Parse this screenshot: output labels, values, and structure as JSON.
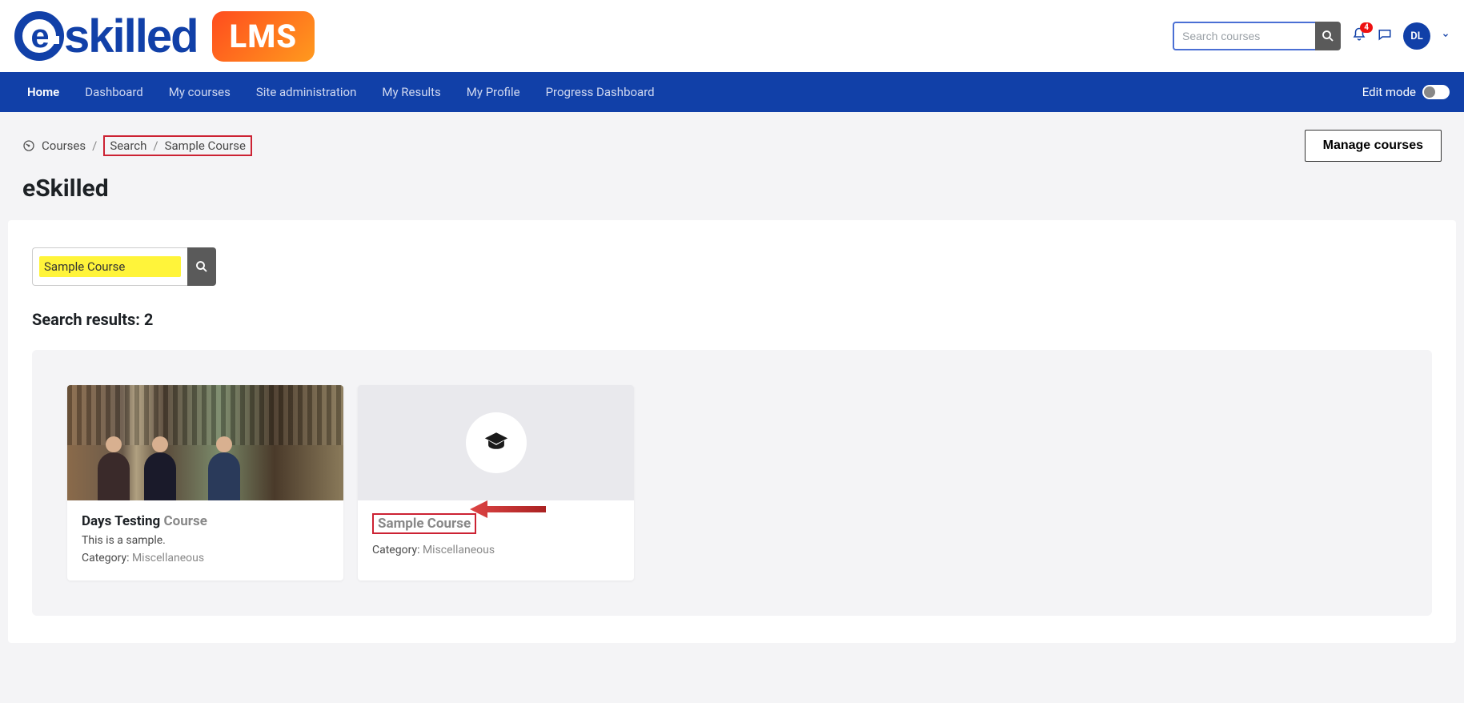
{
  "header": {
    "logo_text": "skilled",
    "logo_lms": "LMS",
    "search_placeholder": "Search courses",
    "notification_count": "4",
    "avatar_initials": "DL"
  },
  "nav": {
    "items": [
      "Home",
      "Dashboard",
      "My courses",
      "Site administration",
      "My Results",
      "My Profile",
      "Progress Dashboard"
    ],
    "active_index": 0,
    "edit_mode_label": "Edit mode"
  },
  "breadcrumb": {
    "root": "Courses",
    "mid": "Search",
    "leaf": "Sample Course"
  },
  "manage_button": "Manage courses",
  "page_title": "eSkilled",
  "main_search_value": "Sample Course",
  "results_heading": "Search results: 2",
  "cards": [
    {
      "title_prefix": "Days Testing ",
      "title_match": "Course",
      "desc": "This is a sample.",
      "cat_label": "Category: ",
      "cat_value": "Miscellaneous"
    },
    {
      "title": "Sample Course",
      "cat_label": "Category: ",
      "cat_value": "Miscellaneous"
    }
  ]
}
